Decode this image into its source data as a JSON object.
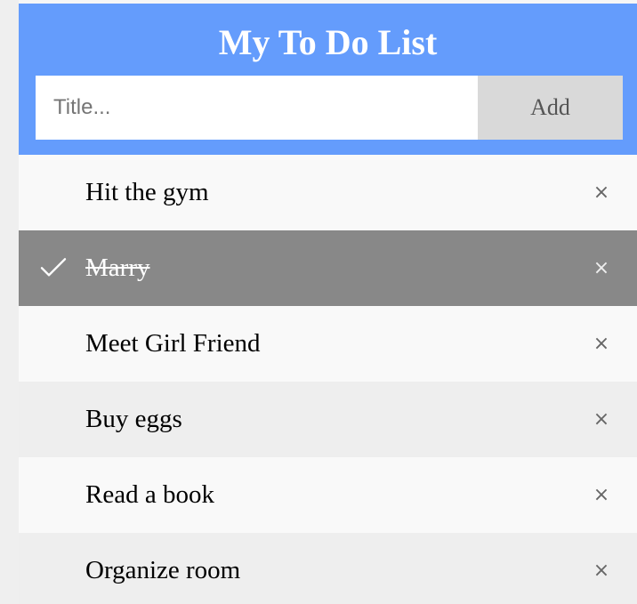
{
  "header": {
    "title": "My To Do List",
    "input_placeholder": "Title...",
    "add_label": "Add"
  },
  "colors": {
    "header_bg": "#649cfc",
    "checked_bg": "#888888",
    "row_odd": "#f9f9f9",
    "row_even": "#eeeeee"
  },
  "todos": [
    {
      "label": "Hit the gym",
      "checked": false,
      "close_icon": "×"
    },
    {
      "label": "Marry",
      "checked": true,
      "close_icon": "×"
    },
    {
      "label": "Meet Girl Friend",
      "checked": false,
      "close_icon": "×"
    },
    {
      "label": "Buy eggs",
      "checked": false,
      "close_icon": "×"
    },
    {
      "label": "Read a book",
      "checked": false,
      "close_icon": "×"
    },
    {
      "label": "Organize room",
      "checked": false,
      "close_icon": "×"
    }
  ]
}
